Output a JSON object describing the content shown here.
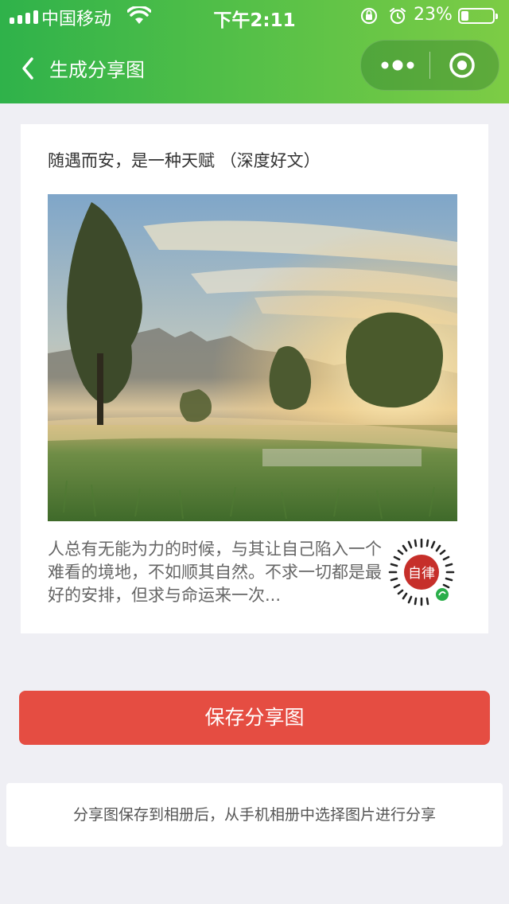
{
  "status_bar": {
    "carrier": "中国移动",
    "time": "下午2:11",
    "battery_percent": "23%",
    "battery_level": 0.23
  },
  "nav": {
    "title": "生成分享图"
  },
  "card": {
    "title": "随遇而安，是一种天赋 （深度好文）",
    "excerpt": "人总有无能为力的时候，与其让自己陷入一个难看的境地，不如顺其自然。不求一切都是最好的安排，但求与命运来一次...",
    "qr_logo_text": "自律"
  },
  "actions": {
    "save_label": "保存分享图"
  },
  "tip": {
    "text": "分享图保存到相册后，从手机相册中选择图片进行分享"
  },
  "colors": {
    "header_start": "#2fb24a",
    "header_end": "#7dcc45",
    "save_button": "#e54d42",
    "background": "#efeff4"
  }
}
